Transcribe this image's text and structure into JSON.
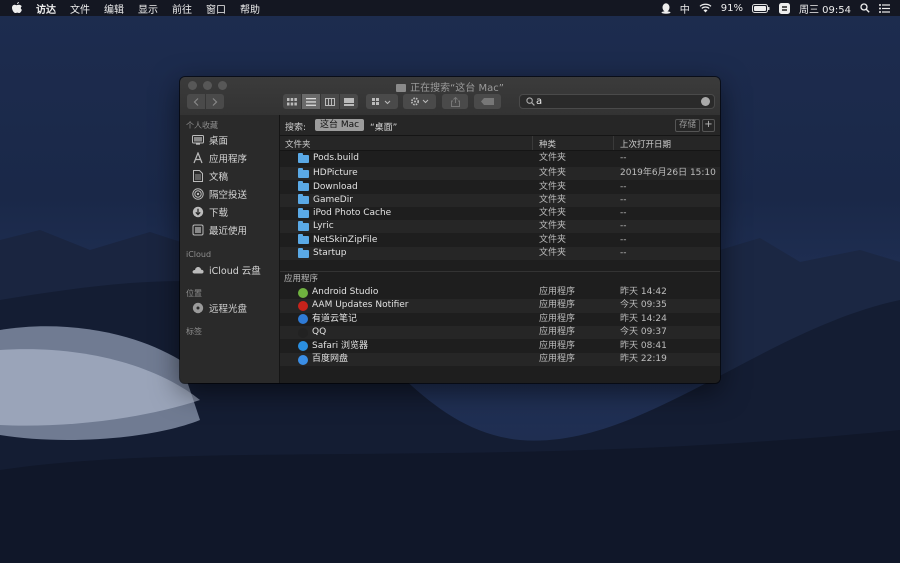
{
  "menubar": {
    "items": [
      "访达",
      "文件",
      "编辑",
      "显示",
      "前往",
      "窗口",
      "帮助"
    ],
    "input_method": "中",
    "battery": "91%",
    "clock": "周三 09:54"
  },
  "window": {
    "title": "正在搜索“这台 Mac”",
    "search_value": "a"
  },
  "sidebar": {
    "favorites_header": "个人收藏",
    "favorites": [
      "桌面",
      "应用程序",
      "文稿",
      "隔空投送",
      "下载",
      "最近使用"
    ],
    "icloud_header": "iCloud",
    "icloud": [
      "iCloud 云盘"
    ],
    "locations_header": "位置",
    "locations": [
      "远程光盘"
    ],
    "tags_header": "标签"
  },
  "scope": {
    "label": "搜索:",
    "this_mac": "这台 Mac",
    "desktop": "“桌面”",
    "save": "存储",
    "add": "+"
  },
  "columns": {
    "name": "文件夹",
    "kind": "种类",
    "date": "上次打开日期"
  },
  "folders_section": "文件夹",
  "folders": [
    {
      "name": "Pods.build",
      "kind": "文件夹",
      "date": "--"
    },
    {
      "name": "HDPicture",
      "kind": "文件夹",
      "date": "2019年6月26日 15:10"
    },
    {
      "name": "Download",
      "kind": "文件夹",
      "date": "--"
    },
    {
      "name": "GameDir",
      "kind": "文件夹",
      "date": "--"
    },
    {
      "name": "iPod Photo Cache",
      "kind": "文件夹",
      "date": "--"
    },
    {
      "name": "Lyric",
      "kind": "文件夹",
      "date": "--"
    },
    {
      "name": "NetSkinZipFile",
      "kind": "文件夹",
      "date": "--"
    },
    {
      "name": "Startup",
      "kind": "文件夹",
      "date": "--"
    }
  ],
  "apps_section": "应用程序",
  "apps": [
    {
      "name": "Android Studio",
      "kind": "应用程序",
      "date": "昨天 14:42",
      "color": "#6fb23f"
    },
    {
      "name": "AAM Updates Notifier",
      "kind": "应用程序",
      "date": "今天 09:35",
      "color": "#c8231b"
    },
    {
      "name": "有道云笔记",
      "kind": "应用程序",
      "date": "昨天 14:24",
      "color": "#2f7bd6"
    },
    {
      "name": "QQ",
      "kind": "应用程序",
      "date": "今天 09:37",
      "color": "#222222"
    },
    {
      "name": "Safari 浏览器",
      "kind": "应用程序",
      "date": "昨天 08:41",
      "color": "#2b8fe0"
    },
    {
      "name": "百度网盘",
      "kind": "应用程序",
      "date": "昨天 22:19",
      "color": "#3a8ee6"
    }
  ]
}
